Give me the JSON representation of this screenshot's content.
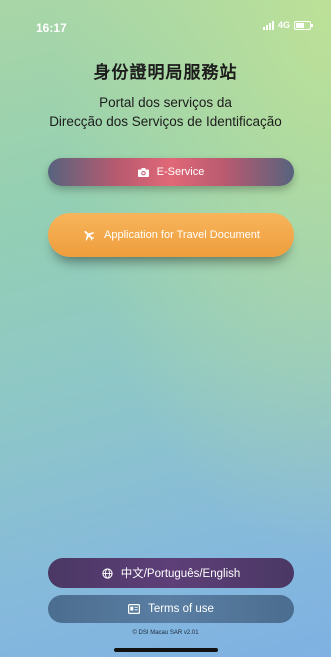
{
  "status_bar": {
    "time": "16:17",
    "network": "4G"
  },
  "header": {
    "title_zh": "身份證明局服務站",
    "title_pt_line1": "Portal dos serviços da",
    "title_pt_line2": "Direcção dos Serviços de Identificação"
  },
  "buttons": {
    "eservice_label": "E-Service",
    "travel_label": "Application for Travel Document",
    "language_label": "中文/Português/English",
    "terms_label": "Terms of use"
  },
  "footer": {
    "text": "© DSI Macau SAR v2.01"
  },
  "colors": {
    "eservice_center": "#e06877",
    "travel": "#f2a647",
    "language": "#553d6f",
    "terms": "#547a9d"
  },
  "icons": {
    "eservice": "camera-icon",
    "travel": "airplane-icon",
    "language": "globe-icon",
    "terms": "id-card-icon"
  }
}
